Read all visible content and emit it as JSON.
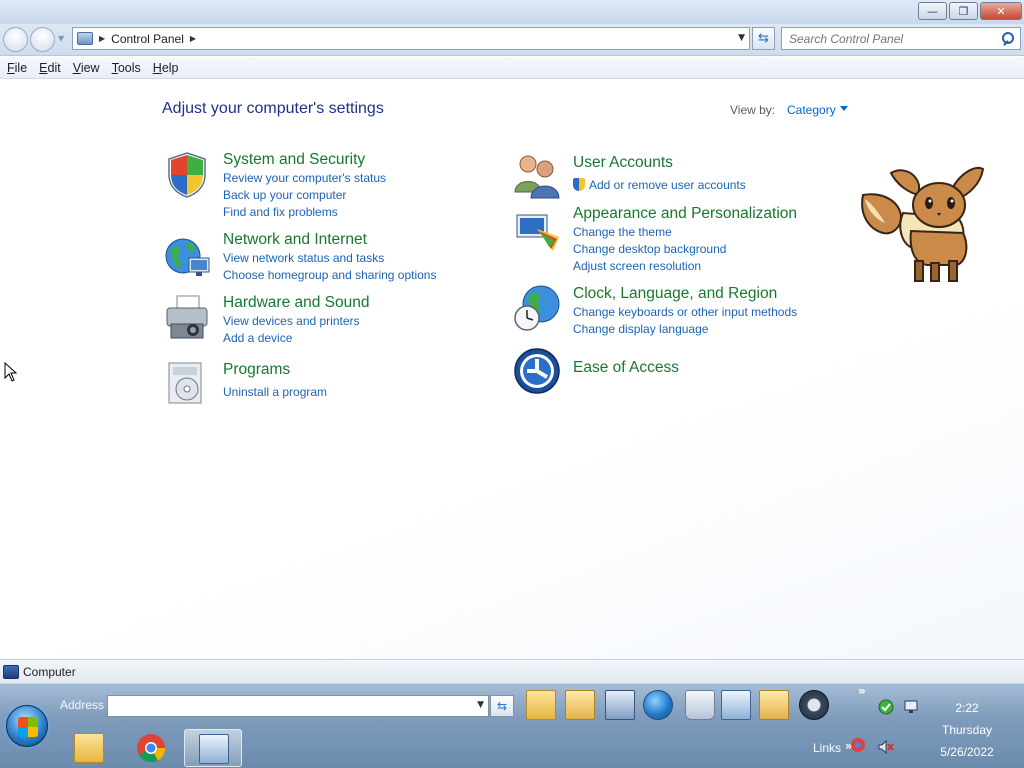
{
  "window": {
    "minimize_label": "—",
    "maximize_label": "❐",
    "close_label": "✕"
  },
  "nav": {
    "breadcrumb": "Control Panel",
    "search_placeholder": "Search Control Panel"
  },
  "menu": [
    "File",
    "Edit",
    "View",
    "Tools",
    "Help"
  ],
  "page": {
    "title": "Adjust your computer's settings",
    "view_by_label": "View by:",
    "view_by_value": "Category"
  },
  "categories": [
    {
      "title": "System and Security",
      "links": [
        "Review your computer's status",
        "Back up your computer",
        "Find and fix problems"
      ]
    },
    {
      "title": "Network and Internet",
      "links": [
        "View network status and tasks",
        "Choose homegroup and sharing options"
      ]
    },
    {
      "title": "Hardware and Sound",
      "links": [
        "View devices and printers",
        "Add a device"
      ]
    },
    {
      "title": "Programs",
      "links": [
        "Uninstall a program"
      ]
    },
    {
      "title": "User Accounts",
      "links": [
        "Add or remove user accounts"
      ]
    },
    {
      "title": "Appearance and Personalization",
      "links": [
        "Change the theme",
        "Change desktop background",
        "Adjust screen resolution"
      ]
    },
    {
      "title": "Clock, Language, and Region",
      "links": [
        "Change keyboards or other input methods",
        "Change display language"
      ]
    },
    {
      "title": "Ease of Access",
      "links": []
    }
  ],
  "status": {
    "text": "Computer"
  },
  "taskbar": {
    "address_label": "Address",
    "address_value": "",
    "links_label": "Links",
    "overflow": "»",
    "clock_time": "2:22",
    "clock_day": "Thursday",
    "clock_date": "5/26/2022"
  }
}
